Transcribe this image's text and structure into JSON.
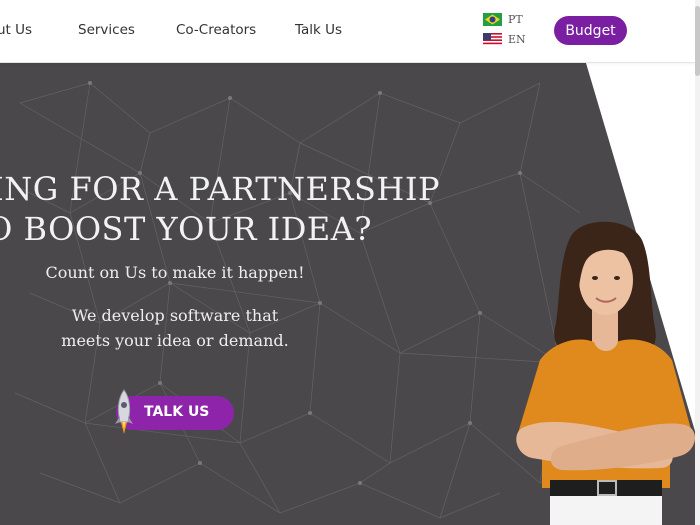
{
  "nav": {
    "items": [
      {
        "label": "ut Us"
      },
      {
        "label": "Services"
      },
      {
        "label": "Co-Creators"
      },
      {
        "label": "Talk Us"
      }
    ]
  },
  "languages": [
    {
      "code": "PT",
      "flag": "brazil-flag-icon"
    },
    {
      "code": "EN",
      "flag": "usa-flag-icon"
    }
  ],
  "budget_label": "Budget",
  "hero": {
    "headline_line1": "KING FOR A PARTNERSHIP",
    "headline_line2": "O BOOST YOUR IDEA?",
    "subtitle": "Count on Us to make it happen!",
    "description_line1": "We develop software that",
    "description_line2": "meets your idea or demand.",
    "cta_label": "TALK US"
  },
  "colors": {
    "brand_purple": "#7b1fa2",
    "hero_dark": "#4a484b",
    "shirt_orange": "#e08a1e"
  }
}
